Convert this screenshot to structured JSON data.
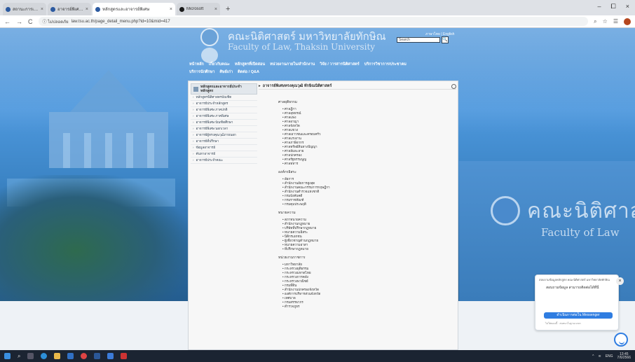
{
  "browser": {
    "tabs": [
      {
        "label": "สถานะการเป็นอาจารย์พิเศษ คณะ"
      },
      {
        "label": "อาจารย์พิเศษ / Thaksin Unive"
      },
      {
        "label": "หลักสูตรและอาจารย์พิเศษ"
      },
      {
        "label": "Microsoft"
      }
    ],
    "active_tab": 2,
    "new_tab": "+",
    "window_controls": [
      "–",
      "⧠",
      "×"
    ],
    "nav": {
      "back": "←",
      "forward": "→",
      "reload": "C"
    },
    "security_label": "ⓘ ไม่ปลอดภัย",
    "url": "law.tsu.ac.th/page_detail_menu.php?id=10&mid=417"
  },
  "site": {
    "name_th": "คณะนิติศาสตร์ มหาวิทยาลัยทักษิณ",
    "name_en": "Faculty of Law, Thaksin University",
    "lang_links": "ภาษาไทย | English",
    "search_placeholder": "Search",
    "search_button": "🔍",
    "menu_row1": [
      "หน้าหลัก",
      "เกี่ยวกับคณะ",
      "หลักสูตรที่เปิดสอน",
      "หน่วยงานภายใน/สำนักงาน",
      "วิจัย / วารสารนิติศาสตร์",
      "บริการวิชาการ/ประชาคม"
    ],
    "menu_row2": [
      "บริการนักศึกษา",
      "ศิษย์เก่า",
      "ติดต่อ / Q&A"
    ],
    "banner_th": "คณะนิติศาสตร์",
    "banner_en": "Faculty of Law"
  },
  "sidebar": {
    "title": "หลักสูตรและอาจารย์ประจำหลักสูตร",
    "items": [
      "หลักสูตรนิติศาสตรบัณฑิต",
      "อาจารย์ประจำหลักสูตร",
      "อาจารย์พิเศษ ภาคปกติ",
      "อาจารย์พิเศษ ภาคพิเศษ",
      "อาจารย์พิเศษ บัณฑิตศึกษา",
      "อาจารย์พิเศษ นอกเวลา",
      "อาจารย์ผู้ทรงคุณวุฒิภายนอก",
      "อาจารย์ที่ปรึกษา",
      "ข้อมูลอาจารย์",
      "ค้นหาอาจารย์",
      "อาจารย์ประจำคณะ"
    ]
  },
  "main": {
    "title": "อาจารย์พิเศษทรงคุณวุฒิ ทักษิณนิติศาสตร์",
    "sections": [
      {
        "heading": "ศาลยุติธรรม",
        "items": [
          "ศาลฎีกา",
          "ศาลอุทธรณ์",
          "ศาลแพ่ง",
          "ศาลอาญา",
          "ศาลจังหวัด",
          "ศาลแขวง",
          "ศาลเยาวชนและครอบครัว",
          "ศาลแรงงาน",
          "ศาลภาษีอากร",
          "ศาลทรัพย์สินทางปัญญา",
          "ศาลล้มละลาย",
          "ศาลปกครอง",
          "ศาลรัฐธรรมนูญ",
          "ศาลทหาร"
        ]
      },
      {
        "heading": "องค์กรอิสระ",
        "items": [
          "อัยการ",
          "สำนักงานอัยการสูงสุด",
          "สำนักงานคณะกรรมการกฤษฎีกา",
          "สำนักงานตำรวจแห่งชาติ",
          "กรมบังคับคดี",
          "กรมราชทัณฑ์",
          "กรมคุมประพฤติ"
        ]
      },
      {
        "heading": "ทนายความ",
        "items": [
          "สภาทนายความ",
          "สำนักงานกฎหมาย",
          "บริษัทที่ปรึกษากฎหมาย",
          "ทนายความอิสระ",
          "นิติกรเอกชน",
          "ผู้เชี่ยวชาญด้านกฎหมาย",
          "ทนายความอาสา",
          "ที่ปรึกษากฎหมาย"
        ]
      },
      {
        "heading": "หน่วยงานราชการ",
        "items": [
          "มหาวิทยาลัย",
          "กระทรวงยุติธรรม",
          "กระทรวงมหาดไทย",
          "กระทรวงการคลัง",
          "กระทรวงพาณิชย์",
          "กรมที่ดิน",
          "สำนักงานปกครองจังหวัด",
          "องค์การบริหารส่วนจังหวัด",
          "เทศบาล",
          "กรมสรรพากร",
          "ตำรวจภูธร"
        ]
      }
    ]
  },
  "chat": {
    "header": "สอบถามข้อมูลหลักสูตร คณะนิติศาสตร์ มหาวิทยาลัยทักษิณ",
    "message": "สอบถามข้อมูล สามารถติดต่อได้ที่นี่",
    "button": "ดำเนินการต่อใน Messenger",
    "footer": "ไม่ใช่ตอนนี้ · สนทนาในฐานะแขก",
    "close": "×"
  },
  "taskbar": {
    "clock_time": "13:45",
    "clock_date": "7/6/2566",
    "tray": "ENG"
  },
  "colors": {
    "banner": "#3f8ad0",
    "taskbar": "#1b2432",
    "messenger": "#2f7de1"
  }
}
